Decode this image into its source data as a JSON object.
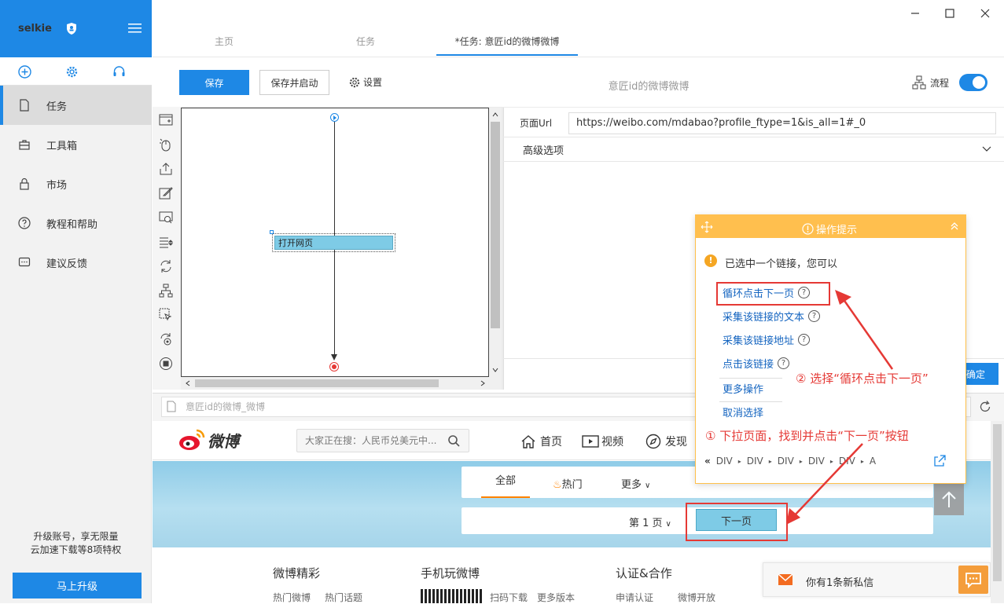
{
  "sidebar": {
    "brand": "selkie",
    "items": [
      {
        "label": "任务",
        "icon": "document-icon"
      },
      {
        "label": "工具箱",
        "icon": "toolbox-icon"
      },
      {
        "label": "市场",
        "icon": "lock-icon"
      },
      {
        "label": "教程和帮助",
        "icon": "help-icon"
      },
      {
        "label": "建议反馈",
        "icon": "chat-icon"
      }
    ],
    "upgrade_line1": "升级账号，享无限量",
    "upgrade_line2": "云加速下载等8项特权",
    "upgrade_button": "马上升级"
  },
  "tabs": [
    {
      "label": "主页"
    },
    {
      "label": "任务"
    },
    {
      "label": "*任务: 意匠id的微博微博"
    }
  ],
  "toolbar": {
    "save": "保存",
    "save_run": "保存并启动",
    "settings": "设置",
    "task_title": "意匠id的微博微博",
    "flow_label": "流程",
    "flow_enabled": true
  },
  "workflow": {
    "node_label": "打开网页"
  },
  "right_panel": {
    "url_label": "页面Url",
    "url_value": "https://weibo.com/mdabao?profile_ftype=1&is_all=1#_0",
    "advanced_label": "高级选项",
    "confirm_label": "确定"
  },
  "browser": {
    "address": "意匠id的微博_微博"
  },
  "weibo": {
    "logo_text": "微博",
    "search_placeholder": "大家正在搜：人民币兑美元中...",
    "nav": [
      "首页",
      "视频",
      "发现"
    ],
    "tab_all": "全部",
    "tab_hot": "热门",
    "tab_more": "更多",
    "page_label": "第 1 页",
    "next_label": "下一页",
    "footer_heads": [
      "微博精彩",
      "手机玩微博",
      "认证&合作"
    ],
    "footer_links": [
      "热门微博",
      "热门话题",
      "扫码下载",
      "更多版本",
      "申请认证",
      "微博开放"
    ],
    "message": "你有1条新私信"
  },
  "popup": {
    "title": "操作提示",
    "message": "已选中一个链接，您可以",
    "links": [
      "循环点击下一页",
      "采集该链接的文本",
      "采集该链接地址",
      "点击该链接",
      "更多操作",
      "取消选择"
    ],
    "breadcrumb": [
      "DIV",
      "DIV",
      "DIV",
      "DIV",
      "DIV",
      "A"
    ]
  },
  "annotations": {
    "step2": "② 选择“循环点击下一页”",
    "step1": "① 下拉页面，找到并点击“下一页”按钮"
  },
  "colors": {
    "accent": "#1e88e5",
    "popup": "#ffbf4e",
    "annotation": "#e53935"
  }
}
